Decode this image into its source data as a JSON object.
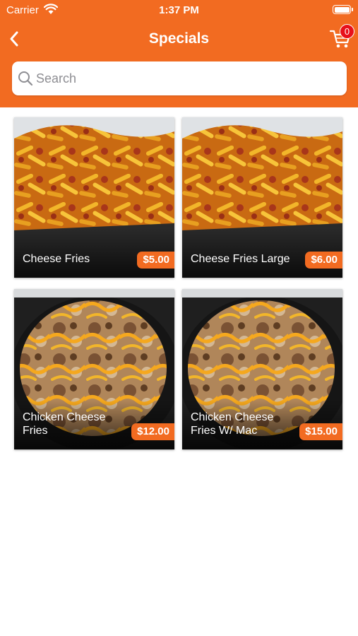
{
  "status_bar": {
    "carrier": "Carrier",
    "time": "1:37 PM"
  },
  "nav": {
    "title": "Specials",
    "cart_count": "0",
    "back_icon": "chevron-left-icon",
    "cart_icon": "cart-icon"
  },
  "search": {
    "placeholder": "Search",
    "value": ""
  },
  "colors": {
    "brand": "#f26b21",
    "badge": "#e8101a"
  },
  "products": [
    {
      "name": "Cheese Fries",
      "price": "$5.00",
      "image": "cheese-fries-photo"
    },
    {
      "name": "Cheese Fries Large",
      "price": "$6.00",
      "image": "cheese-fries-photo"
    },
    {
      "name": "Chicken Cheese Fries",
      "price": "$12.00",
      "image": "chicken-cheese-fries-photo"
    },
    {
      "name": "Chicken Cheese Fries W/ Mac",
      "price": "$15.00",
      "image": "chicken-cheese-fries-photo"
    }
  ]
}
